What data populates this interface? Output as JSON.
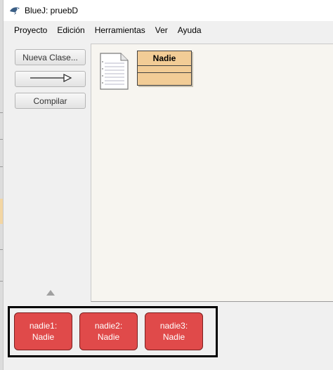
{
  "window": {
    "title": "BlueJ: pruebD",
    "app_icon": "bluej-bird-icon"
  },
  "menu": {
    "items": [
      "Proyecto",
      "Edición",
      "Herramientas",
      "Ver",
      "Ayuda"
    ]
  },
  "toolbar": {
    "new_class_label": "Nueva Clase...",
    "arrow_icon": "inheritance-arrow-icon",
    "compile_label": "Compilar"
  },
  "diagram": {
    "readme_icon": "readme-document-icon",
    "classes": [
      {
        "name": "Nadie",
        "color": "#f2cc96"
      }
    ]
  },
  "object_bench": {
    "objects": [
      {
        "instance": "nadie1:",
        "type": "Nadie"
      },
      {
        "instance": "nadie2:",
        "type": "Nadie"
      },
      {
        "instance": "nadie3:",
        "type": "Nadie"
      }
    ],
    "object_color": "#e04a4a"
  }
}
